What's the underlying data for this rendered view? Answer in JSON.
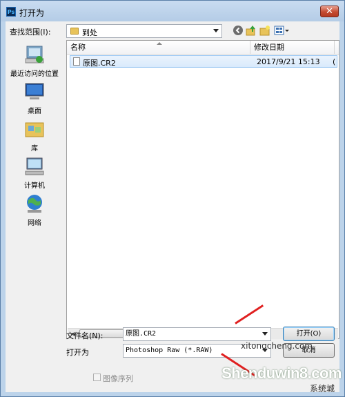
{
  "window": {
    "title": "打开为",
    "app_icon": "Ps",
    "close_glyph": "✕"
  },
  "toolbar": {
    "lookin_label": "查找范围(I):",
    "lookin_value": "到处"
  },
  "sidebar": {
    "items": [
      {
        "label": "最近访问的位置",
        "icon": "recent-places-icon"
      },
      {
        "label": "桌面",
        "icon": "desktop-icon"
      },
      {
        "label": "库",
        "icon": "libraries-icon"
      },
      {
        "label": "计算机",
        "icon": "computer-icon"
      },
      {
        "label": "网络",
        "icon": "network-icon"
      }
    ]
  },
  "filelist": {
    "columns": [
      "名称",
      "修改日期"
    ],
    "rows": [
      {
        "name": "原图.CR2",
        "date": "2017/9/21 15:13",
        "extra": "("
      }
    ],
    "scroll_thumb_glyph": "|||"
  },
  "form": {
    "filename_label": "文件名(N):",
    "filename_value": "原图.CR2",
    "openas_label": "打开为",
    "openas_value": "Photoshop Raw (*.RAW)",
    "open_button": "打开(O)",
    "cancel_button": "取消",
    "sequence_label": "图像序列"
  },
  "watermark": {
    "top": "xitongcheng.com",
    "main": "Shenduwin8.com",
    "bottom": "系统城"
  },
  "colors": {
    "titlebar": "#bcd3ea",
    "selection": "#d9eafc",
    "arrow": "#e02020",
    "close": "#c44a30"
  }
}
